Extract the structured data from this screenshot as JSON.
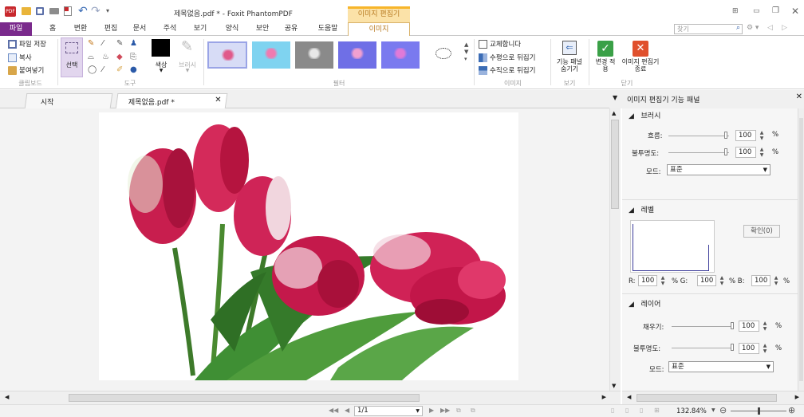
{
  "title": {
    "doc": "제목없음.pdf * - Foxit PhantomPDF",
    "context_tab": "이미지 편집기",
    "search_placeholder": "찾기"
  },
  "tabs": [
    "파일",
    "홈",
    "변환",
    "편집",
    "문서",
    "주석",
    "보기",
    "양식",
    "보안",
    "공유",
    "도움말",
    "이미지"
  ],
  "clipboard": {
    "save": "파일 저장",
    "copy": "복사",
    "paste": "붙여넣기",
    "group": "클립보드"
  },
  "tools": {
    "select": "선택",
    "color": "색상",
    "brush": "브러시",
    "group": "도구"
  },
  "filter": {
    "group": "필터"
  },
  "image": {
    "replace": "교체합니다",
    "flip_h": "수평으로 뒤집기",
    "flip_v": "수직으로 뒤집기",
    "group": "이미지"
  },
  "view": {
    "toggle_panel": "기능 패널 숨기기",
    "group": "보기"
  },
  "close_group": {
    "apply": "변경 적용",
    "close": "이미지 편집기 종료",
    "group": "닫기"
  },
  "doc_tabs": {
    "start": "시작",
    "doc": "제목없음.pdf *"
  },
  "panel": {
    "title": "이미지 편집기 기능 패널",
    "brush": {
      "header": "브러시",
      "flow_label": "흐름:",
      "flow": "100",
      "opacity_label": "불투명도:",
      "opacity": "100",
      "mode_label": "모드:",
      "mode": "표준",
      "unit": "%"
    },
    "level": {
      "header": "레벨",
      "confirm": "확인(0)",
      "r_label": "R:",
      "r": "100",
      "g_label": "% G:",
      "g": "100",
      "b_label": "% B:",
      "b": "100",
      "unit": "%"
    },
    "layer": {
      "header": "레이어",
      "fill_label": "채우기:",
      "fill": "100",
      "opacity_label": "불투명도:",
      "opacity": "100",
      "mode_label": "모드:",
      "mode": "표준",
      "unit": "%"
    }
  },
  "status": {
    "page": "1/1",
    "zoom": "132.84%"
  },
  "colors": {
    "accent": "#f7b52a",
    "file_tab": "#7a2a8c",
    "brush_swatch": "#000000",
    "select_bg": "#e2d6ee"
  }
}
